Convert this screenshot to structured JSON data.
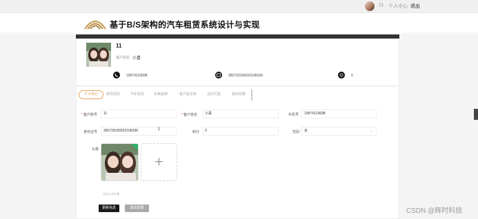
{
  "topbar": {
    "username": "11",
    "personal_center": "个人中心",
    "logout": "退出"
  },
  "header": {
    "title": "基于B/S架构的汽车租赁系统设计与实现"
  },
  "profile": {
    "user_id": "11",
    "name_label": "客户姓名",
    "name_value": "小喜",
    "phone": "15874123698",
    "id_card": "360733199202108336",
    "points": "0"
  },
  "tabs": [
    {
      "label": "个人中心",
      "active": true
    },
    {
      "label": "修改密码"
    },
    {
      "label": "汽车租赁"
    },
    {
      "label": "车辆退换"
    },
    {
      "label": "客户留言板"
    },
    {
      "label": "违法罚金"
    },
    {
      "label": "我的收藏"
    }
  ],
  "form": {
    "account_label": "客户账号",
    "account_value": "11",
    "name_label": "客户姓名",
    "name_value": "小喜",
    "phone_label": "手机号",
    "phone_value": "15874123698",
    "idcard_label": "身份证号",
    "idcard_value": "360733199202108336",
    "points_label": "积分",
    "points_value": "0",
    "gender_label": "性别",
    "gender_value": "女",
    "avatar_label": "头像",
    "upload_hint": "点击上传头像",
    "update_button": "更新信息",
    "logout_button": "退出登录"
  },
  "watermark": "CSDN @辉时科技",
  "colors": {
    "accent": "#e28b3c",
    "dark": "#1a1a1a",
    "success": "#28b266"
  }
}
